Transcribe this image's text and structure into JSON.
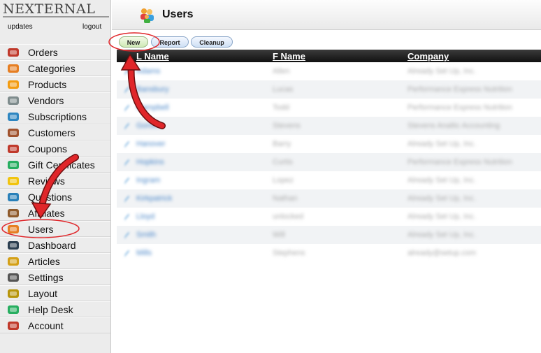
{
  "brand": {
    "logo_text": "NEXTERNAL"
  },
  "top_links": {
    "updates": "updates",
    "logout": "logout"
  },
  "sidebar": {
    "items": [
      {
        "label": "Orders",
        "icon": "basket-icon"
      },
      {
        "label": "Categories",
        "icon": "categories-icon"
      },
      {
        "label": "Products",
        "icon": "products-icon"
      },
      {
        "label": "Vendors",
        "icon": "vendors-icon"
      },
      {
        "label": "Subscriptions",
        "icon": "subscriptions-icon"
      },
      {
        "label": "Customers",
        "icon": "customers-icon"
      },
      {
        "label": "Coupons",
        "icon": "coupons-icon"
      },
      {
        "label": "Gift Certificates",
        "icon": "gift-icon"
      },
      {
        "label": "Reviews",
        "icon": "star-icon"
      },
      {
        "label": "Questions",
        "icon": "info-icon"
      },
      {
        "label": "Affiliates",
        "icon": "affiliates-icon"
      },
      {
        "label": "Users",
        "icon": "users-icon"
      },
      {
        "label": "Dashboard",
        "icon": "dashboard-icon"
      },
      {
        "label": "Articles",
        "icon": "articles-icon"
      },
      {
        "label": "Settings",
        "icon": "gear-icon"
      },
      {
        "label": "Layout",
        "icon": "layout-icon"
      },
      {
        "label": "Help Desk",
        "icon": "help-icon"
      },
      {
        "label": "Account",
        "icon": "calendar-icon"
      }
    ]
  },
  "header": {
    "title": "Users"
  },
  "toolbar": {
    "new_label": "New",
    "report_label": "Report",
    "cleanup_label": "Cleanup"
  },
  "grid": {
    "columns": [
      "L Name",
      "F Name",
      "Company"
    ],
    "rows": [
      {
        "lname": "Adams",
        "fname": "Allen",
        "company": "Already Set Up, Inc."
      },
      {
        "lname": "Bansbury",
        "fname": "Lucas",
        "company": "Performance Express Nutrition"
      },
      {
        "lname": "Campbell",
        "fname": "Todd",
        "company": "Performance Express Nutrition"
      },
      {
        "lname": "Gordon",
        "fname": "Stevens",
        "company": "Stevens Analtic Accounting"
      },
      {
        "lname": "Hanover",
        "fname": "Barry",
        "company": "Already Set Up, Inc."
      },
      {
        "lname": "Hopkins",
        "fname": "Curtis",
        "company": "Performance Express Nutrition"
      },
      {
        "lname": "Ingram",
        "fname": "Lopez",
        "company": "Already Set Up, Inc."
      },
      {
        "lname": "Kirkpatrick",
        "fname": "Nathan",
        "company": "Already Set Up, Inc."
      },
      {
        "lname": "Lloyd",
        "fname": "unlocked",
        "company": "Already Set Up, Inc."
      },
      {
        "lname": "Smith",
        "fname": "Will",
        "company": "Already Set Up, Inc."
      },
      {
        "lname": "Mills",
        "fname": "Stephens",
        "company": "already@setup.com"
      }
    ]
  },
  "colors": {
    "header_bar": "#1a1a1a",
    "annotation_red": "#e0262a",
    "link_blue": "#4a86c8"
  }
}
